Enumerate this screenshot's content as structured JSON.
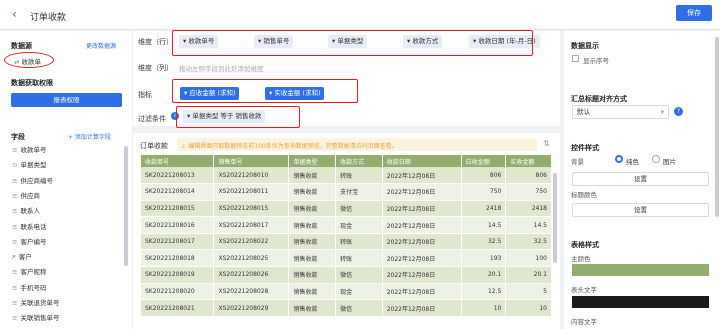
{
  "header": {
    "back_icon": "‹",
    "title": "订单收款",
    "save_label": "保存"
  },
  "left": {
    "datasource_label": "数据源",
    "change_dataset_label": "更改数据源",
    "datasource_name": "收款单",
    "permission_label": "数据获取权限",
    "report_permission_label": "报表权限",
    "fields_label": "字段",
    "add_calc_label": "+ 添加计算字段",
    "fields": [
      {
        "icon": "≡",
        "name": "收款单号"
      },
      {
        "icon": "⊙",
        "name": "单据类型"
      },
      {
        "icon": "≡",
        "name": "供应商编号"
      },
      {
        "icon": "≡",
        "name": "供应商"
      },
      {
        "icon": "≡",
        "name": "联系人"
      },
      {
        "icon": "≡",
        "name": "联系电话"
      },
      {
        "icon": "≡",
        "name": "客户编号"
      },
      {
        "icon": "ዖ",
        "name": "客户"
      },
      {
        "icon": "≡",
        "name": "客户昵称"
      },
      {
        "icon": "≡",
        "name": "手机号码"
      },
      {
        "icon": "≡",
        "name": "关联退货单号"
      },
      {
        "icon": "≡",
        "name": "关联销售单号"
      }
    ]
  },
  "config": {
    "dimension_row_label": "维度（行）",
    "dimension_row_chips": [
      "收款单号",
      "销售单号",
      "单据类型",
      "收款方式",
      "收款日期 (年-月-日)"
    ],
    "dimension_col_label": "维度（列）",
    "dimension_col_placeholder": "拖动左侧字段到此处添加维度",
    "metric_label": "指标",
    "metric_chips": [
      "应收金额 (求和)",
      "实收金额 (求和)"
    ],
    "filter_label": "过滤条件",
    "filter_chip": "单据类型 等于 销售收款"
  },
  "preview": {
    "title": "订单收款",
    "notice": "⚠ 编辑界面只取数据预览前100条作为查询数据预览，完整数据请访问页面查看。",
    "columns": [
      "收款单号",
      "销售单号",
      "单据类型",
      "收款方式",
      "收款日期",
      "应收金额",
      "实收金额"
    ],
    "rows": [
      [
        "SK20221208013",
        "XS20221208010",
        "销售收款",
        "转账",
        "2022年12月08日",
        "806",
        "806"
      ],
      [
        "SK20221208014",
        "XS20221208011",
        "销售收款",
        "支付宝",
        "2022年12月08日",
        "750",
        "750"
      ],
      [
        "SK20221208015",
        "XS20221208015",
        "销售收款",
        "微信",
        "2022年12月08日",
        "2418",
        "2418"
      ],
      [
        "SK20221208016",
        "XS20221208017",
        "销售收款",
        "现金",
        "2022年12月08日",
        "14.5",
        "14.5"
      ],
      [
        "SK20221208017",
        "XS20221208022",
        "销售收款",
        "转账",
        "2022年12月08日",
        "32.5",
        "32.5"
      ],
      [
        "SK20221208018",
        "XS20221208025",
        "销售收款",
        "转账",
        "2022年12月08日",
        "193",
        "100"
      ],
      [
        "SK20221208019",
        "XS20221208026",
        "销售收款",
        "微信",
        "2022年12月08日",
        "20.1",
        "20.1"
      ],
      [
        "SK20221208020",
        "XS20221208028",
        "销售收款",
        "现金",
        "2022年12月08日",
        "12.5",
        "5"
      ],
      [
        "SK20221208021",
        "XS20221208029",
        "销售收款",
        "微信",
        "2022年12月08日",
        "10",
        "10"
      ]
    ]
  },
  "right": {
    "display_label": "数据显示",
    "show_index_label": "显示序号",
    "align_label": "汇总标题对齐方式",
    "align_value": "默认",
    "control_style_label": "控件样式",
    "bg_label": "背景",
    "bg_opt_solid": "纯色",
    "bg_opt_image": "图片",
    "set_label": "设置",
    "title_color_label": "标题颜色",
    "set_label2": "设置",
    "table_style_label": "表格样式",
    "main_color_label": "主颜色",
    "header_text_label": "表头文字",
    "content_text_label": "内容文字",
    "colors": {
      "main": "#93ad6f",
      "header_text": "#1a1a1a"
    }
  }
}
